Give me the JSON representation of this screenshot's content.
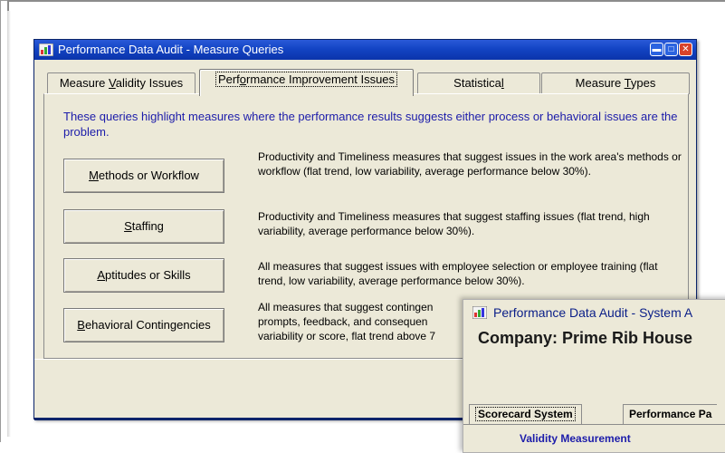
{
  "main_window": {
    "title": "Performance Data Audit - Measure Queries",
    "tabs": [
      {
        "pre": "Measure ",
        "accel": "V",
        "post": "alidity Issues"
      },
      {
        "pre": "Perf",
        "accel": "o",
        "post": "rmance Improvement Issues"
      },
      {
        "pre": "Statistica",
        "accel": "l",
        "post": ""
      },
      {
        "pre": "Measure ",
        "accel": "T",
        "post": "ypes"
      }
    ],
    "active_tab_index": 1,
    "intro": "These queries highlight measures where the performance results suggests either process or behavioral issues are the problem.",
    "queries": [
      {
        "button": {
          "pre": "",
          "accel": "M",
          "post": "ethods or Workflow"
        },
        "description": "Productivity and Timeliness measures that suggest issues in the work area's methods or workflow (flat trend, low variability, average performance below 30%)."
      },
      {
        "button": {
          "pre": "",
          "accel": "S",
          "post": "taffing"
        },
        "description": "Productivity and Timeliness measures that suggest staffing issues (flat trend, high variability, average performance below 30%)."
      },
      {
        "button": {
          "pre": "",
          "accel": "A",
          "post": "ptitudes or Skills"
        },
        "description": "All measures that suggest issues with employee selection or employee training (flat trend, low variability, average performance below 30%)."
      },
      {
        "button": {
          "pre": "",
          "accel": "B",
          "post": "ehavioral Contingencies"
        },
        "description": "All measures that suggest contingen prompts, feedback, and consequen variability or score, flat trend above 7"
      }
    ]
  },
  "second_window": {
    "title": "Performance Data Audit - System A",
    "company": "Company:  Prime Rib House",
    "tabs": [
      "Scorecard System",
      "Performance Pa"
    ],
    "section_heading": "Validity Measurement"
  },
  "colors": {
    "title_bar": "#1344c4",
    "window_bg": "#ece9d8",
    "intro_text": "#1c1caa"
  }
}
